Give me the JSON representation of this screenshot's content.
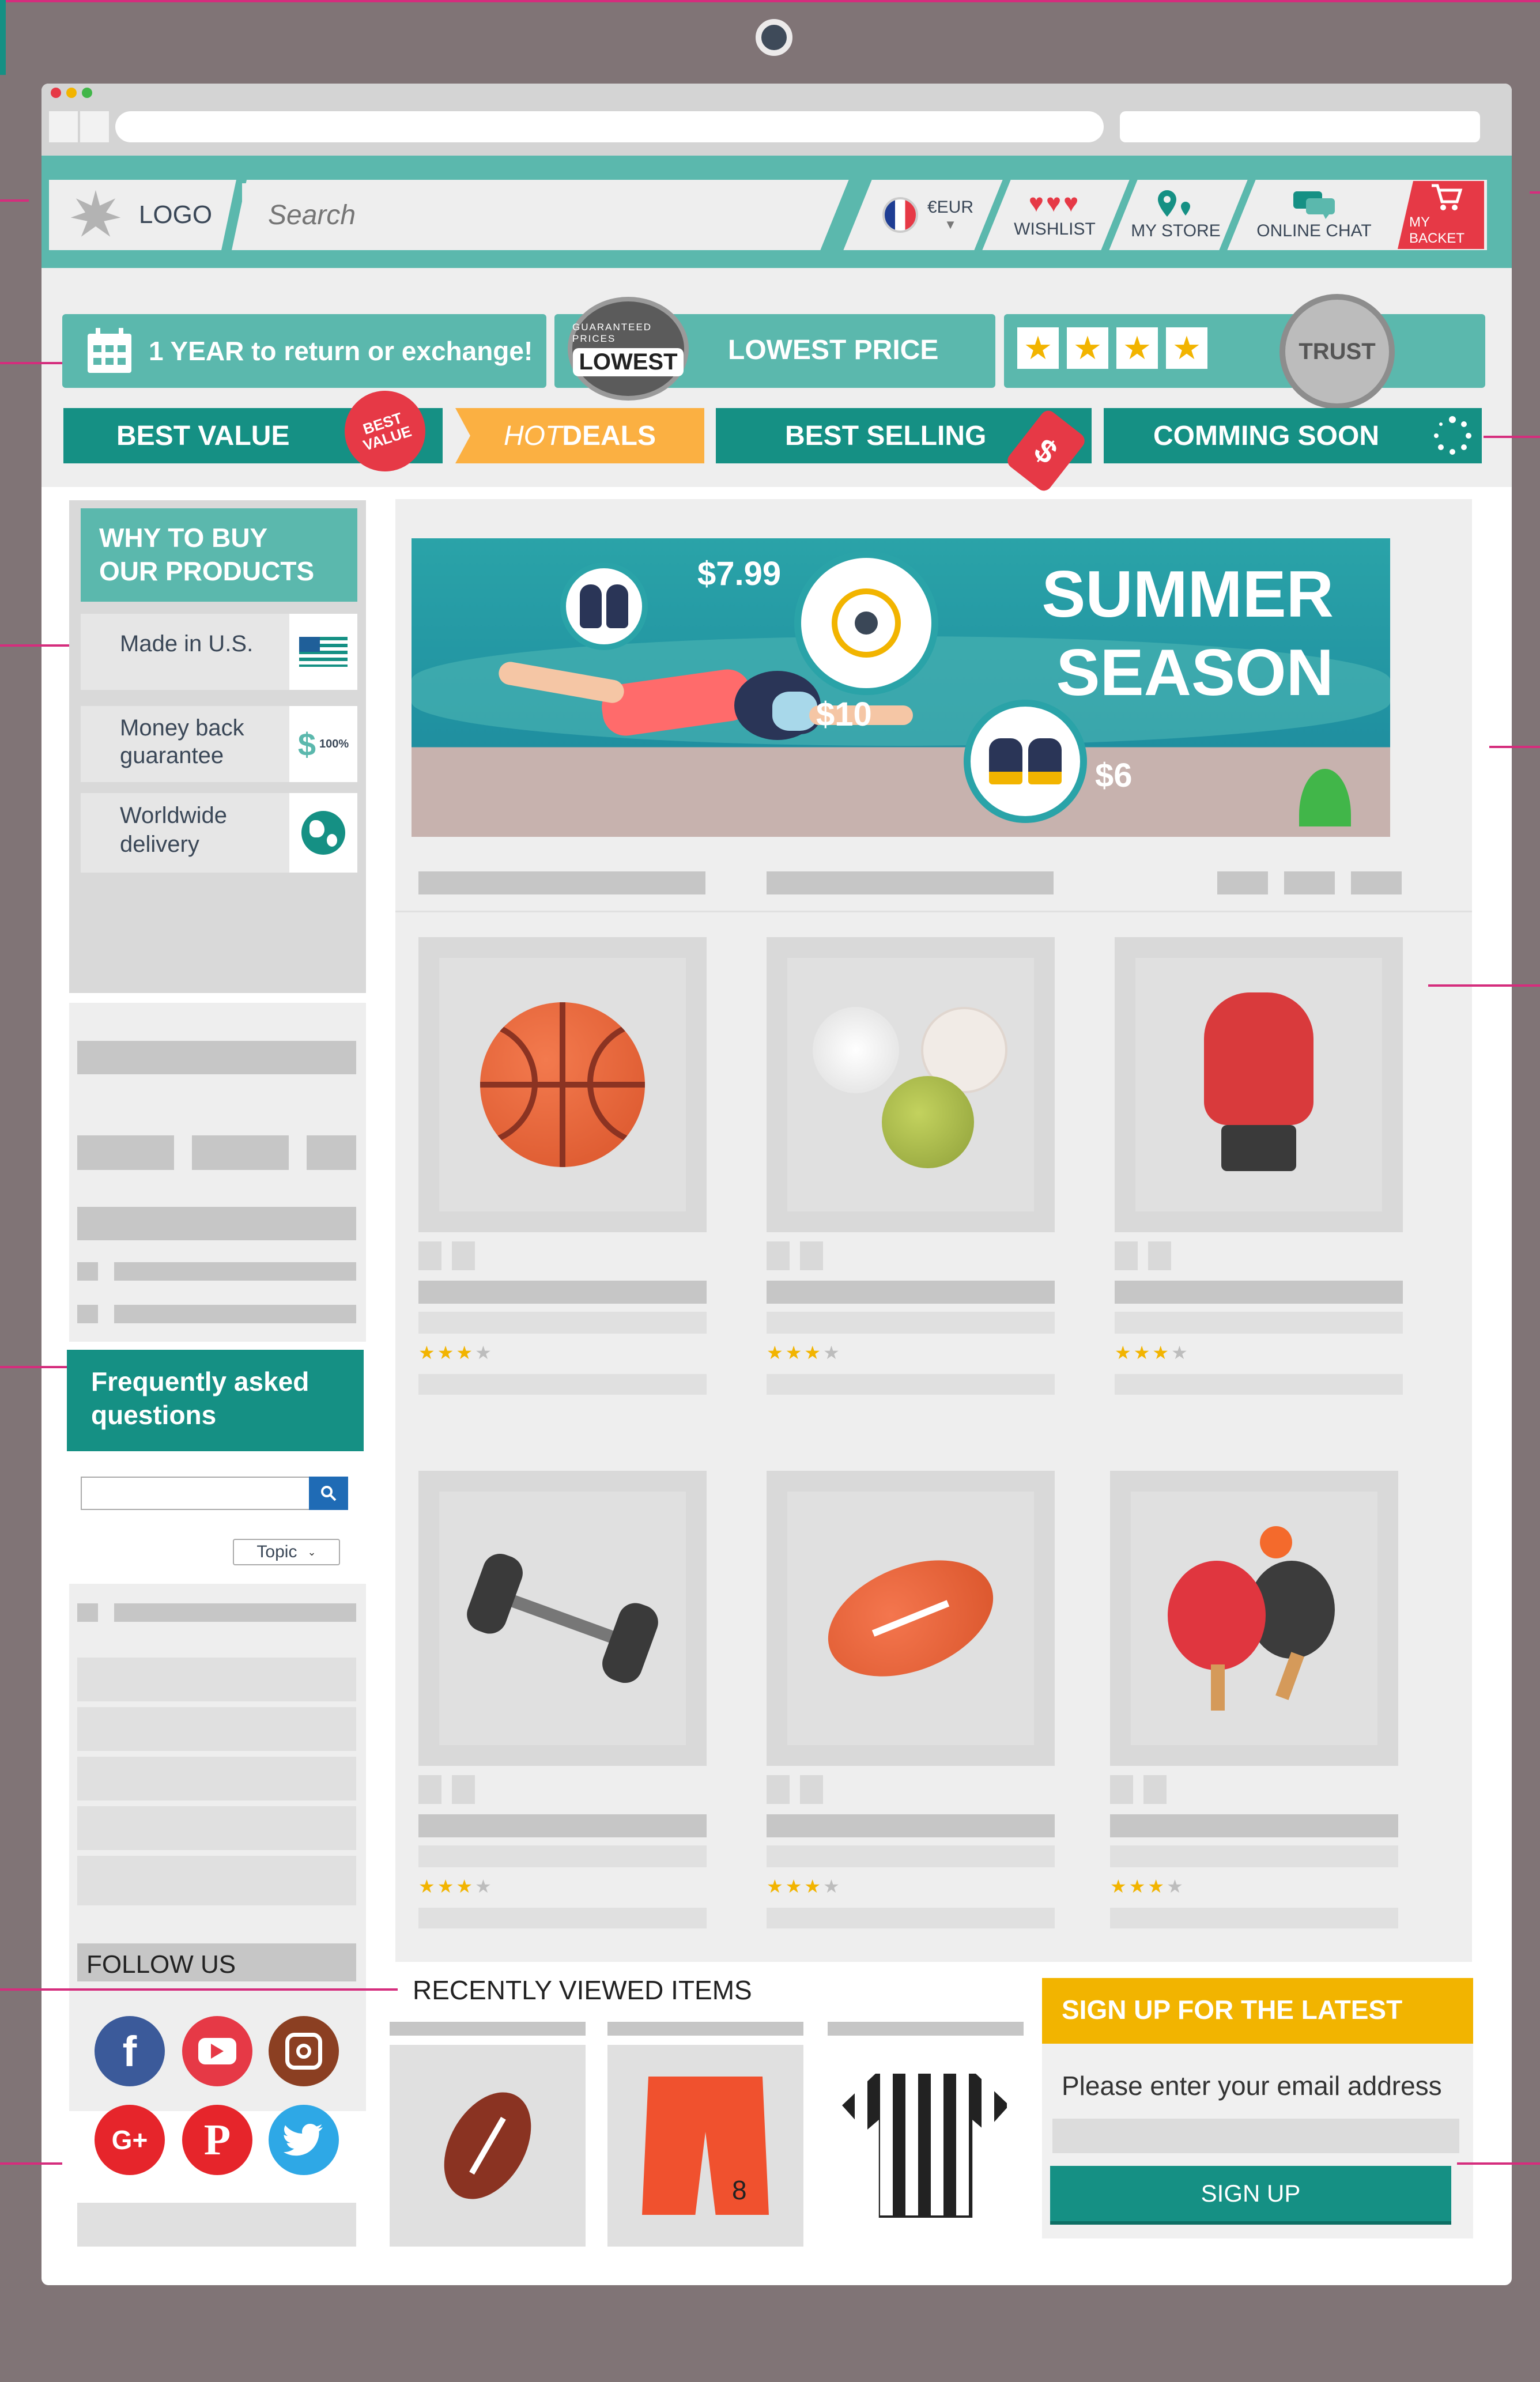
{
  "header": {
    "logo_label": "LOGO",
    "search_placeholder": "Search",
    "currency": "€EUR",
    "nav": [
      {
        "label": "WISHLIST",
        "icon": "hearts-icon"
      },
      {
        "label": "MY STORE",
        "icon": "map-pin-icon"
      },
      {
        "label": "ONLINE CHAT",
        "icon": "chat-bubbles-icon"
      },
      {
        "label": "MY BACKET",
        "icon": "cart-icon"
      }
    ]
  },
  "promo": {
    "return": "1 YEAR to return or exchange!",
    "lowest_badge": "LOWEST",
    "lowest_badge_ring": "GUARANTEED PRICES",
    "lowest_price": "LOWEST PRICE",
    "rating_stars": 4,
    "trust": "TRUST"
  },
  "tabs": [
    {
      "label": "BEST VALUE",
      "badge": "BEST VALUE"
    },
    {
      "label_hot": "HOT",
      "label_deals": "DEALS"
    },
    {
      "label": "BEST SELLING"
    },
    {
      "label": "COMMING SOON"
    }
  ],
  "sidebar": {
    "why_title": "WHY TO BUY OUR PRODUCTS",
    "why_items": [
      {
        "label": "Made in U.S.",
        "icon": "us-flag-icon"
      },
      {
        "label": "Money back guarantee",
        "icon": "money-back-icon",
        "badge": "100%"
      },
      {
        "label": "Worldwide delivery",
        "icon": "globe-icon"
      }
    ],
    "faq_title": "Frequently asked questions",
    "faq_topic": "Topic",
    "follow_title": "FOLLOW US",
    "social": [
      "facebook-icon",
      "youtube-icon",
      "instagram-icon",
      "google-plus-icon",
      "pinterest-icon",
      "twitter-icon"
    ]
  },
  "banner": {
    "title_line1": "SUMMER",
    "title_line2": "SEASON",
    "prices": [
      "$7.99",
      "$10",
      "$6"
    ]
  },
  "products": [
    {
      "icon": "basketball-icon",
      "rating": 3
    },
    {
      "icon": "balls-icon",
      "rating": 3
    },
    {
      "icon": "boxing-glove-icon",
      "rating": 3
    },
    {
      "icon": "dumbbell-icon",
      "rating": 3
    },
    {
      "icon": "american-football-icon",
      "rating": 3
    },
    {
      "icon": "ping-pong-icon",
      "rating": 3
    }
  ],
  "recent": {
    "title": "RECENTLY VIEWED ITEMS",
    "items": [
      {
        "icon": "football-icon"
      },
      {
        "icon": "shorts-icon",
        "number": "8"
      },
      {
        "icon": "referee-shirt-icon"
      }
    ]
  },
  "signup": {
    "title": "SIGN UP FOR THE LATEST",
    "prompt": "Please enter your email address",
    "button": "SIGN UP"
  },
  "colors": {
    "teal": "#5bb8ad",
    "teal_dark": "#159084",
    "orange": "#fbb042",
    "yellow": "#f2b400",
    "red": "#e63946"
  }
}
